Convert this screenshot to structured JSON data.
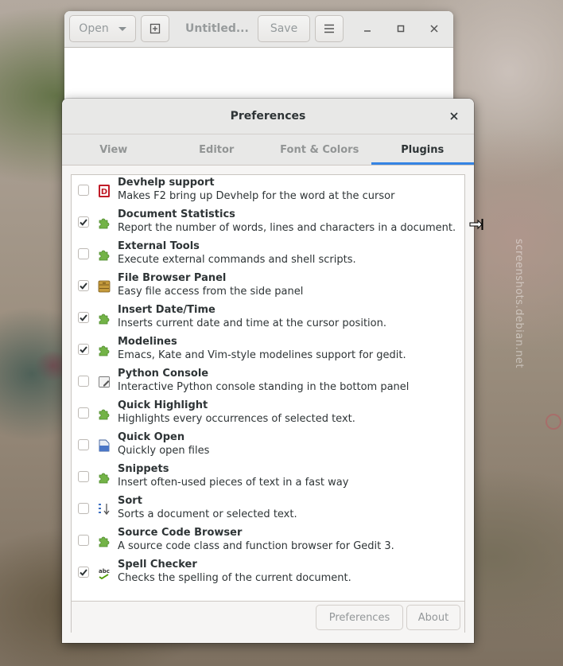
{
  "background": {
    "watermark": "screenshots.debian.net"
  },
  "gedit": {
    "open_label": "Open",
    "title": "Untitled...",
    "save_label": "Save",
    "icons": [
      "new-tab-icon",
      "hamburger-menu-icon",
      "minimize-icon",
      "maximize-icon",
      "close-icon"
    ]
  },
  "dialog": {
    "title": "Preferences",
    "tabs": [
      {
        "label": "View",
        "active": false
      },
      {
        "label": "Editor",
        "active": false
      },
      {
        "label": "Font & Colors",
        "active": false
      },
      {
        "label": "Plugins",
        "active": true
      }
    ],
    "plugins": [
      {
        "name": "Devhelp support",
        "description": "Makes F2 bring up Devhelp for the word at the cursor",
        "enabled": false,
        "icon": "devhelp-icon"
      },
      {
        "name": "Document Statistics",
        "description": "Report the number of words, lines and characters in a document.",
        "enabled": true,
        "icon": "puzzle-icon"
      },
      {
        "name": "External Tools",
        "description": "Execute external commands and shell scripts.",
        "enabled": false,
        "icon": "puzzle-icon"
      },
      {
        "name": "File Browser Panel",
        "description": "Easy file access from the side panel",
        "enabled": true,
        "icon": "file-cabinet-icon"
      },
      {
        "name": "Insert Date/Time",
        "description": "Inserts current date and time at the cursor position.",
        "enabled": true,
        "icon": "puzzle-icon"
      },
      {
        "name": "Modelines",
        "description": "Emacs, Kate and Vim-style modelines support for gedit.",
        "enabled": true,
        "icon": "puzzle-icon"
      },
      {
        "name": "Python Console",
        "description": "Interactive Python console standing in the bottom panel",
        "enabled": false,
        "icon": "console-icon"
      },
      {
        "name": "Quick Highlight",
        "description": "Highlights every occurrences of selected text.",
        "enabled": false,
        "icon": "puzzle-icon"
      },
      {
        "name": "Quick Open",
        "description": "Quickly open files",
        "enabled": false,
        "icon": "open-document-icon"
      },
      {
        "name": "Snippets",
        "description": "Insert often-used pieces of text in a fast way",
        "enabled": false,
        "icon": "puzzle-icon"
      },
      {
        "name": "Sort",
        "description": "Sorts a document or selected text.",
        "enabled": false,
        "icon": "sort-icon"
      },
      {
        "name": "Source Code Browser",
        "description": "A source code class and function browser for Gedit 3.",
        "enabled": false,
        "icon": "puzzle-icon"
      },
      {
        "name": "Spell Checker",
        "description": "Checks the spelling of the current document.",
        "enabled": true,
        "icon": "spell-check-icon"
      }
    ],
    "footer": {
      "preferences_label": "Preferences",
      "about_label": "About"
    }
  }
}
